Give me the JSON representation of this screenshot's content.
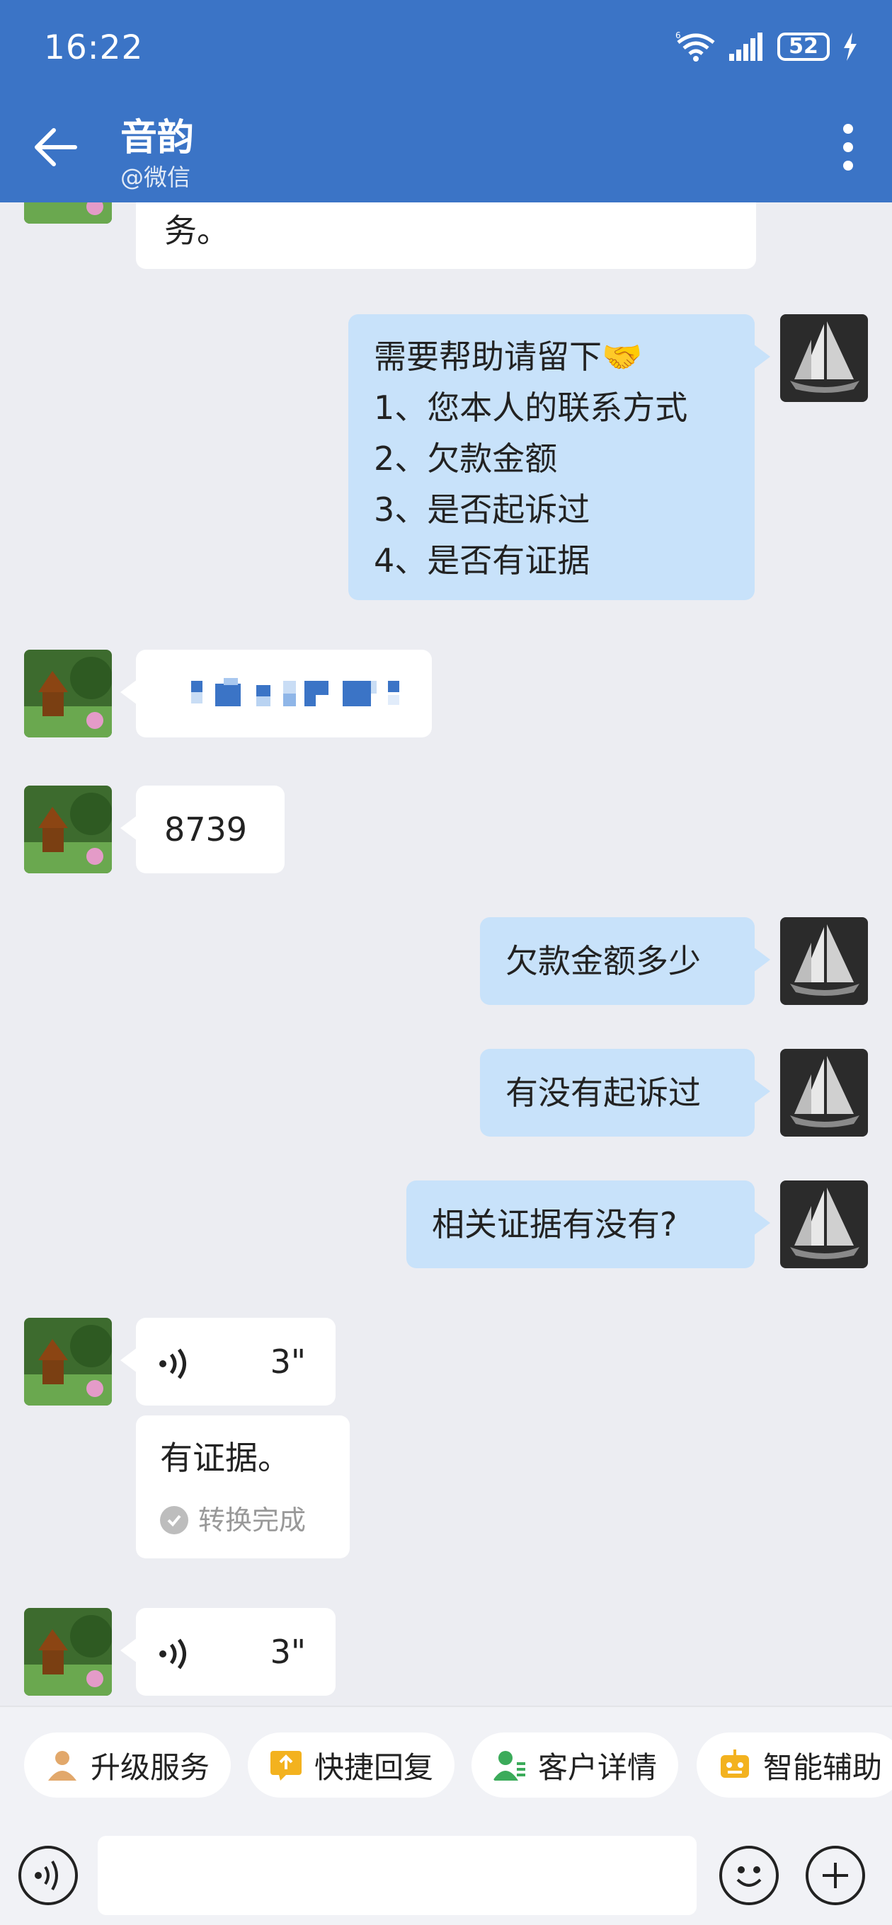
{
  "status_bar": {
    "time": "16:22",
    "battery": "52"
  },
  "header": {
    "name": "音韵",
    "source": "@微信"
  },
  "messages": [
    {
      "side": "in",
      "lines": [
        "务。"
      ]
    },
    {
      "side": "out",
      "lines": [
        "需要帮助请留下🤝",
        "1、您本人的联系方式",
        "2、欠款金额",
        "3、是否起诉过",
        "4、是否有证据"
      ]
    },
    {
      "side": "in",
      "masked": true
    },
    {
      "side": "in",
      "lines": [
        "8739"
      ]
    },
    {
      "side": "out",
      "lines": [
        "欠款金额多少"
      ]
    },
    {
      "side": "out",
      "lines": [
        "有没有起诉过"
      ]
    },
    {
      "side": "out",
      "lines": [
        "相关证据有没有?"
      ]
    },
    {
      "side": "in",
      "voice_duration": "3\"",
      "transcript": "有证据。",
      "convert_status": "转换完成"
    },
    {
      "side": "in",
      "voice_duration": "3\""
    }
  ],
  "quick_actions": [
    {
      "label": "升级服务",
      "icon": "person-upgrade-icon",
      "color": "#e2a86b"
    },
    {
      "label": "快捷回复",
      "icon": "quick-reply-icon",
      "color": "#f3b21f"
    },
    {
      "label": "客户详情",
      "icon": "customer-detail-icon",
      "color": "#3bab5a"
    },
    {
      "label": "智能辅助",
      "icon": "ai-assist-icon",
      "color": "#f3b21f"
    }
  ],
  "input": {
    "placeholder": ""
  },
  "colors": {
    "header": "#3b74c6",
    "outgoing_bubble": "#c8e2fa",
    "incoming_bubble": "#ffffff",
    "background": "#ecedf2"
  }
}
